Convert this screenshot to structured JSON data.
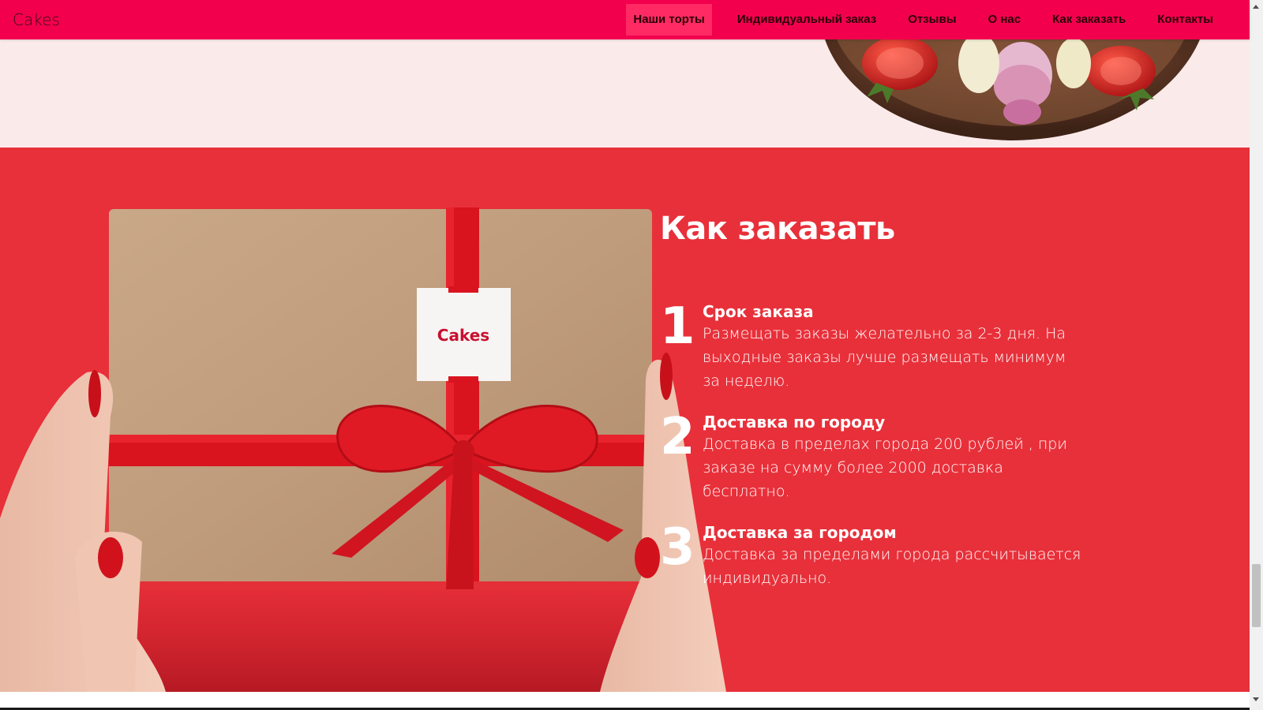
{
  "navbar": {
    "brand": "Cakes",
    "items": [
      {
        "label": "Наши торты",
        "active": true
      },
      {
        "label": "Индивидуальный заказ"
      },
      {
        "label": "Отзывы"
      },
      {
        "label": "О нас"
      },
      {
        "label": "Как заказать"
      },
      {
        "label": "Контакты"
      }
    ]
  },
  "how_to_order": {
    "title": "Как заказать",
    "gift_tag": "Cakes",
    "steps": [
      {
        "number": "1",
        "title": "Срок заказа",
        "text": "Размещать заказы желательно за 2-3 дня. На выходные заказы лучше размещать минимум за неделю."
      },
      {
        "number": "2",
        "title": "Доставка по городу",
        "text": "Доставка в пределах города 200 рублей , при заказе на сумму более 2000 доставка бесплатно."
      },
      {
        "number": "3",
        "title": "Доставка за городом",
        "text": "Доставка за пределами города рассчитывается индивидуально."
      }
    ]
  },
  "colors": {
    "navbar": "#f2004e",
    "nav_active": "#ff2a63",
    "section_red": "#e8303a",
    "top_bg": "#fbeaea"
  }
}
